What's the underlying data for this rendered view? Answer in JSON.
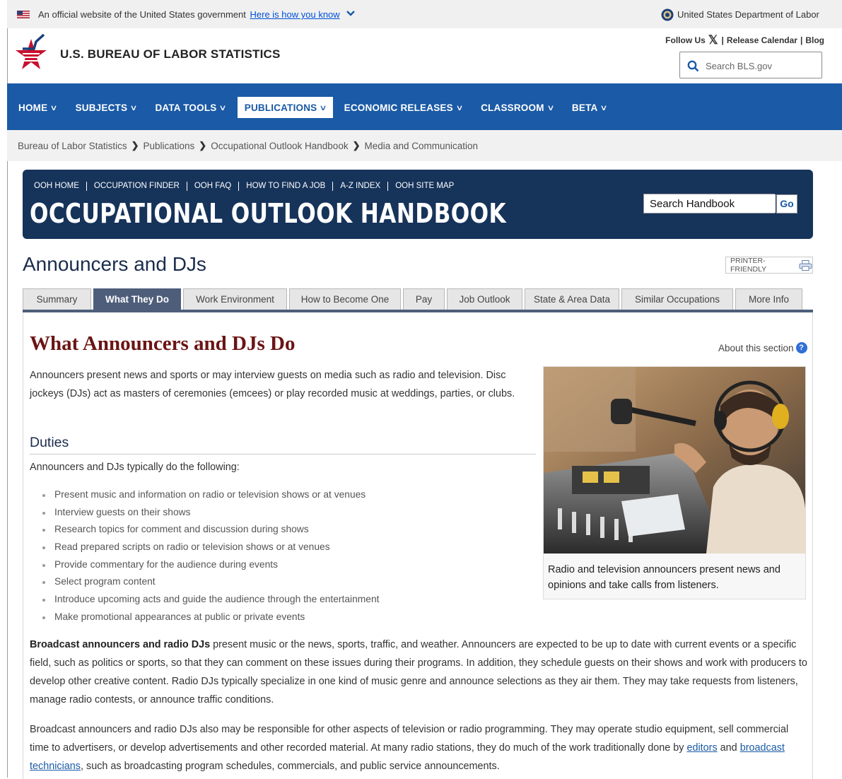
{
  "gov_banner": {
    "official_text": "An official website of the United States government",
    "how_link": "Here is how you know",
    "dol": "United States Department of Labor"
  },
  "header": {
    "bls_name": "U.S. BUREAU OF LABOR STATISTICS",
    "follow_us": "Follow Us",
    "sep1": "|",
    "release_calendar": "Release Calendar",
    "sep2": "|",
    "blog": "Blog",
    "search_placeholder": "Search BLS.gov"
  },
  "nav": {
    "items": [
      "HOME",
      "SUBJECTS",
      "DATA TOOLS",
      "PUBLICATIONS",
      "ECONOMIC RELEASES",
      "CLASSROOM",
      "BETA"
    ],
    "chevron": "∨"
  },
  "breadcrumb": [
    "Bureau of Labor Statistics",
    "Publications",
    "Occupational Outlook Handbook",
    "Media and Communication"
  ],
  "breadcrumb_sep": "❯",
  "ooh": {
    "links": [
      "OOH HOME",
      "OCCUPATION FINDER",
      "OOH FAQ",
      "HOW TO FIND A JOB",
      "A-Z INDEX",
      "OOH SITE MAP"
    ],
    "title": "OCCUPATIONAL OUTLOOK HANDBOOK",
    "search_value": "Search Handbook",
    "go": "Go"
  },
  "occupation": {
    "title": "Announcers and DJs",
    "printer": "PRINTER-FRIENDLY"
  },
  "tabs": [
    "Summary",
    "What They Do",
    "Work Environment",
    "How to Become One",
    "Pay",
    "Job Outlook",
    "State & Area Data",
    "Similar Occupations",
    "More Info"
  ],
  "section": {
    "heading": "What Announcers and DJs Do",
    "about": "About this section",
    "about_icon": "?",
    "intro": "Announcers present news and sports or may interview guests on media such as radio and television. Disc jockeys (DJs) act as masters of ceremonies (emcees) or play recorded music at weddings, parties, or clubs.",
    "duties_heading": "Duties",
    "duties_lead": "Announcers and DJs typically do the following:",
    "duties": [
      "Present music and information on radio or television shows or at venues",
      "Interview guests on their shows",
      "Research topics for comment and discussion during shows",
      "Read prepared scripts on radio or television shows or at venues",
      "Provide commentary for the audience during events",
      "Select program content",
      "Introduce upcoming acts and guide the audience through the entertainment",
      "Make promotional appearances at public or private events"
    ],
    "caption": "Radio and television announcers present news and opinions and take calls from listeners.",
    "b1_bold": "Broadcast announcers and radio DJs",
    "b1_rest": " present music or the news, sports, traffic, and weather. Announcers are expected to be up to date with current events or a specific field, such as politics or sports, so that they can comment on these issues during their programs. In addition, they schedule guests on their shows and work with producers to develop other creative content. Radio DJs typically specialize in one kind of music genre and announce selections as they air them. They may take requests from listeners, manage radio contests, or announce traffic conditions.",
    "b2_start": "Broadcast announcers and radio DJs also may be responsible for other aspects of television or radio programming. They may operate studio equipment, sell commercial time to advertisers, or develop advertisements and other recorded material. At many radio stations, they do much of the work traditionally done by ",
    "b2_link1": "editors",
    "b2_mid": " and ",
    "b2_link2": "broadcast technicians",
    "b2_end": ", such as broadcasting program schedules, commercials, and public service announcements."
  }
}
